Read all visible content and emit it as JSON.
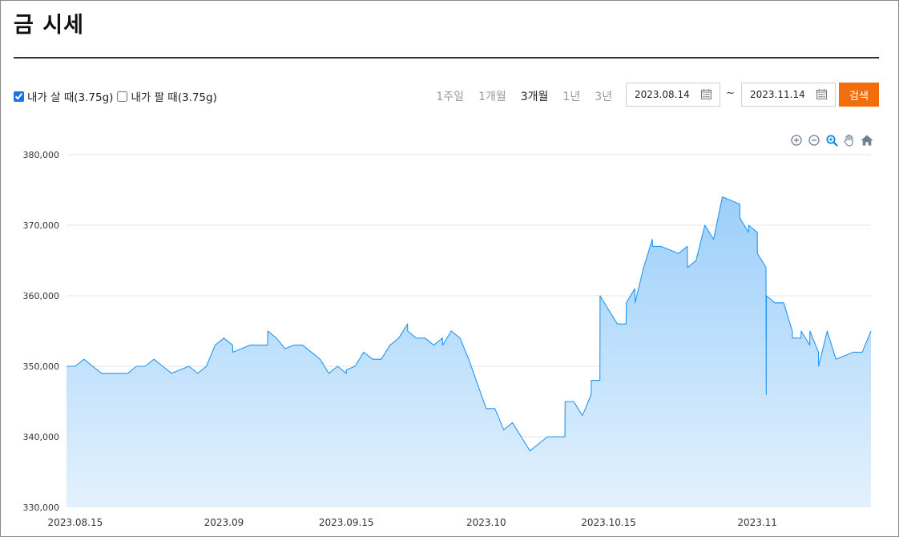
{
  "page": {
    "title": "금 시세"
  },
  "filters": {
    "buy_label": "내가 살 때(3.75g)",
    "buy_checked": true,
    "sell_label": "내가 팔 때(3.75g)",
    "sell_checked": false
  },
  "periods": [
    {
      "label": "1주일",
      "active": false
    },
    {
      "label": "1개월",
      "active": false
    },
    {
      "label": "3개월",
      "active": true
    },
    {
      "label": "1년",
      "active": false
    },
    {
      "label": "3년",
      "active": false
    }
  ],
  "date_range": {
    "start": "2023.08.14",
    "separator": "~",
    "end": "2023.11.14"
  },
  "search_label": "검색",
  "toolbar_icons": [
    "zoom-in-icon",
    "zoom-out-icon",
    "zoom-select-icon",
    "pan-hand-icon",
    "reset-home-icon"
  ],
  "colors": {
    "accent": "#f26e0c",
    "line": "#2196f3",
    "fill_top": "#9ccffa",
    "fill_bottom": "#e3f1fd"
  },
  "chart_data": {
    "type": "area",
    "title": "",
    "xlabel": "",
    "ylabel": "",
    "ylim": [
      330000,
      380000
    ],
    "xlim": [
      "2023-08-14",
      "2023-11-14"
    ],
    "yticks": [
      330000,
      340000,
      350000,
      360000,
      370000,
      380000
    ],
    "ytick_labels": [
      "330,000",
      "340,000",
      "350,000",
      "360,000",
      "370,000",
      "380,000"
    ],
    "xticks": [
      "2023-08-15",
      "2023-09-01",
      "2023-09-15",
      "2023-10-01",
      "2023-10-15",
      "2023-11-01"
    ],
    "xtick_labels": [
      "2023.08.15",
      "2023.09",
      "2023.09.15",
      "2023.10",
      "2023.10.15",
      "2023.11"
    ],
    "grid": true,
    "series": [
      {
        "x": [
          "2023-08-14",
          "2023-08-15",
          "2023-08-16",
          "2023-08-17",
          "2023-08-18",
          "2023-08-21",
          "2023-08-22",
          "2023-08-23",
          "2023-08-24",
          "2023-08-25",
          "2023-08-25",
          "2023-08-26",
          "2023-08-28",
          "2023-08-29",
          "2023-08-30",
          "2023-08-31",
          "2023-09-01",
          "2023-09-02",
          "2023-09-02",
          "2023-09-04",
          "2023-09-05",
          "2023-09-06",
          "2023-09-06",
          "2023-09-07",
          "2023-09-08",
          "2023-09-09",
          "2023-09-10",
          "2023-09-11",
          "2023-09-12",
          "2023-09-13",
          "2023-09-14",
          "2023-09-15",
          "2023-09-15",
          "2023-09-16",
          "2023-09-17",
          "2023-09-18",
          "2023-09-19",
          "2023-09-20",
          "2023-09-20",
          "2023-09-21",
          "2023-09-22",
          "2023-09-22",
          "2023-09-23",
          "2023-09-24",
          "2023-09-25",
          "2023-09-26",
          "2023-09-26",
          "2023-09-27",
          "2023-09-28",
          "2023-09-29",
          "2023-10-01",
          "2023-10-02",
          "2023-10-03",
          "2023-10-04",
          "2023-10-05",
          "2023-10-06",
          "2023-10-08",
          "2023-10-09",
          "2023-10-10",
          "2023-10-10",
          "2023-10-11",
          "2023-10-12",
          "2023-10-13",
          "2023-10-13",
          "2023-10-14",
          "2023-10-14",
          "2023-10-15",
          "2023-10-16",
          "2023-10-17",
          "2023-10-17",
          "2023-10-18",
          "2023-10-18",
          "2023-10-19",
          "2023-10-20",
          "2023-10-20",
          "2023-10-21",
          "2023-10-23",
          "2023-10-24",
          "2023-10-24",
          "2023-10-25",
          "2023-10-26",
          "2023-10-27",
          "2023-10-28",
          "2023-10-28",
          "2023-10-30",
          "2023-10-30",
          "2023-10-31",
          "2023-10-31",
          "2023-11-01",
          "2023-11-01",
          "2023-11-02",
          "2023-11-02",
          "2023-11-02",
          "2023-11-03",
          "2023-11-04",
          "2023-11-04",
          "2023-11-05",
          "2023-11-05",
          "2023-11-06",
          "2023-11-06",
          "2023-11-07",
          "2023-11-07",
          "2023-11-08",
          "2023-11-08",
          "2023-11-09",
          "2023-11-10",
          "2023-11-12",
          "2023-11-13",
          "2023-11-14"
        ],
        "values": [
          350000,
          350000,
          351000,
          350000,
          349000,
          349000,
          350000,
          350000,
          351000,
          350000,
          350000,
          349000,
          350000,
          349000,
          350000,
          353000,
          354000,
          353000,
          352000,
          353000,
          353000,
          353000,
          355000,
          354000,
          352500,
          353000,
          353000,
          352000,
          351000,
          349000,
          350000,
          349000,
          349500,
          350000,
          352000,
          351000,
          351000,
          353000,
          353000,
          354000,
          356000,
          355000,
          354000,
          354000,
          353000,
          354000,
          353000,
          355000,
          354000,
          351000,
          344000,
          344000,
          341000,
          342000,
          340000,
          338000,
          340000,
          340000,
          340000,
          345000,
          345000,
          343000,
          346000,
          348000,
          348000,
          360000,
          358000,
          356000,
          356000,
          359000,
          361000,
          359000,
          364000,
          368000,
          367000,
          367000,
          366000,
          367000,
          364000,
          365000,
          370000,
          368000,
          374000,
          374000,
          373000,
          371000,
          369000,
          370000,
          369000,
          366000,
          364000,
          346000,
          360000,
          359000,
          359000,
          359000,
          355000,
          354000,
          354000,
          355000,
          353000,
          355000,
          352000,
          350000,
          355000,
          351000,
          352000,
          352000,
          355000
        ]
      }
    ]
  }
}
